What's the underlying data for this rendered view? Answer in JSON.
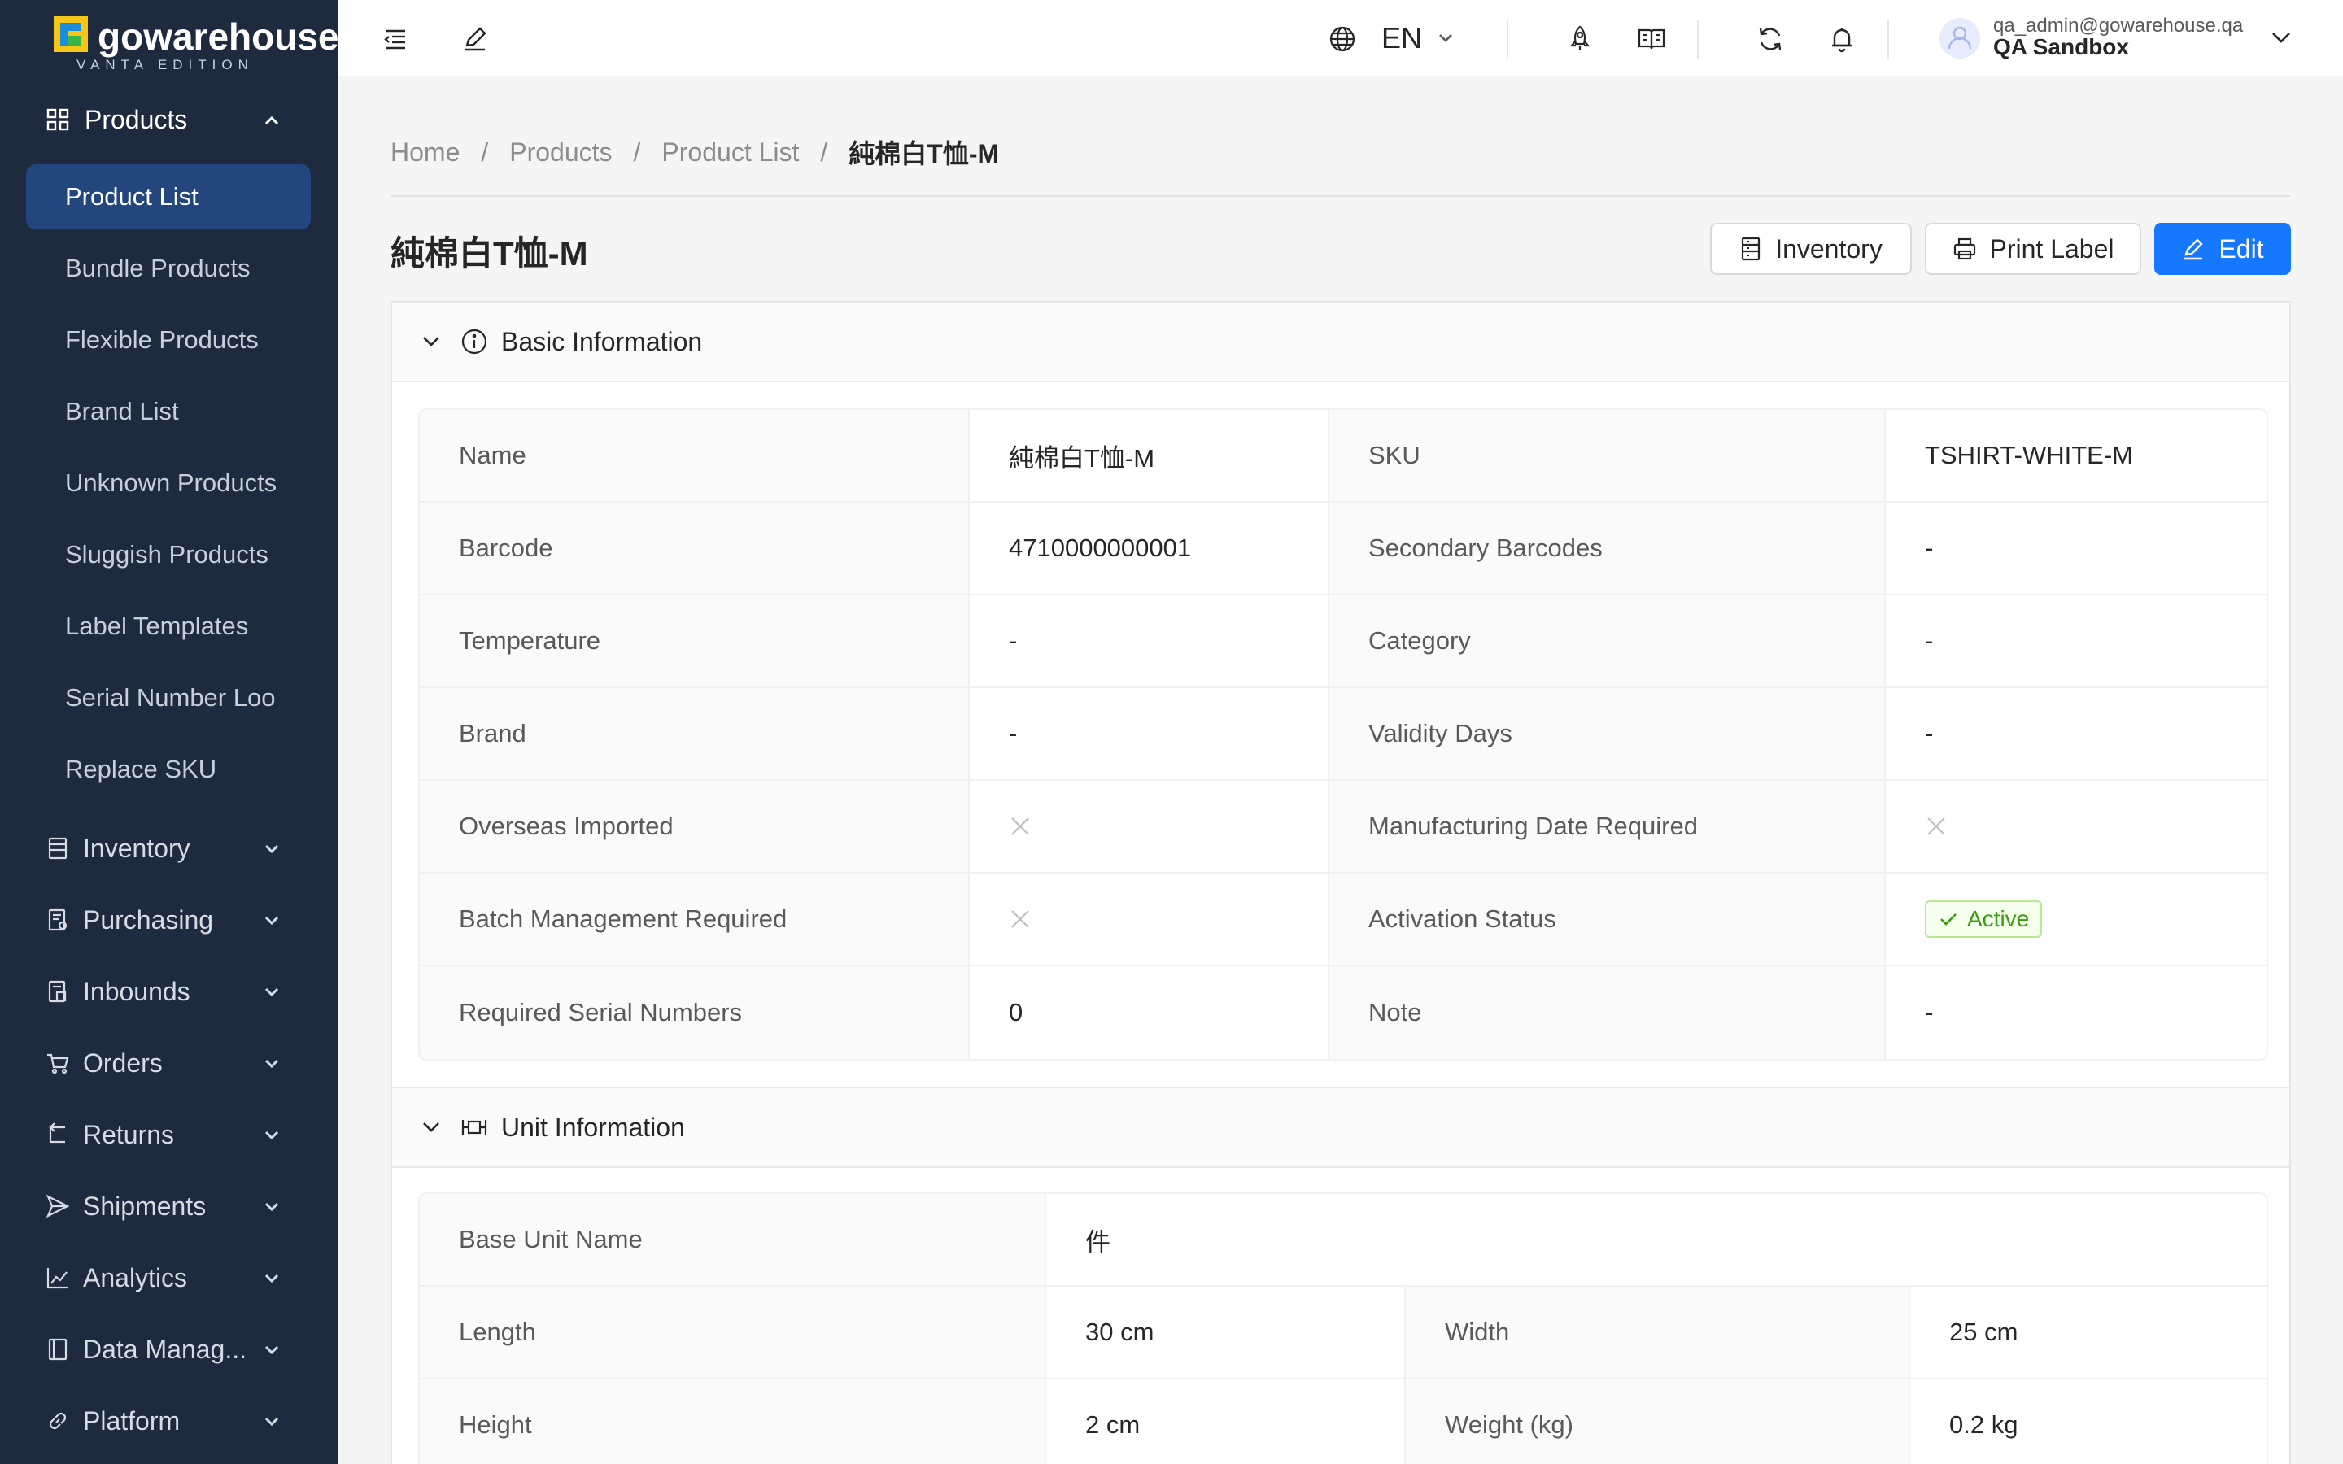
{
  "brand": {
    "name": "gowarehouse",
    "edition": "VANTA EDITION",
    "colors": {
      "yellow": "#f5c518",
      "blue": "#1a8fd8",
      "green": "#3bb54a"
    }
  },
  "sidebar": {
    "section": {
      "label": "Products",
      "icon": "grid-icon",
      "expanded": true
    },
    "sub_items": [
      {
        "label": "Product List",
        "active": true
      },
      {
        "label": "Bundle Products"
      },
      {
        "label": "Flexible Products"
      },
      {
        "label": "Brand List"
      },
      {
        "label": "Unknown Products"
      },
      {
        "label": "Sluggish Products"
      },
      {
        "label": "Label Templates"
      },
      {
        "label": "Serial Number Loo"
      },
      {
        "label": "Replace SKU"
      }
    ],
    "menu": [
      {
        "label": "Inventory",
        "icon": "inventory-icon"
      },
      {
        "label": "Purchasing",
        "icon": "purchasing-icon"
      },
      {
        "label": "Inbounds",
        "icon": "inbounds-icon"
      },
      {
        "label": "Orders",
        "icon": "cart-icon"
      },
      {
        "label": "Returns",
        "icon": "return-icon"
      },
      {
        "label": "Shipments",
        "icon": "send-icon"
      },
      {
        "label": "Analytics",
        "icon": "line-chart-icon"
      },
      {
        "label": "Data Manag...",
        "icon": "book-icon"
      },
      {
        "label": "Platform",
        "icon": "link-icon"
      }
    ]
  },
  "topbar": {
    "language": "EN",
    "user_email": "qa_admin@gowarehouse.qa",
    "user_org": "QA Sandbox"
  },
  "breadcrumb": {
    "items": [
      "Home",
      "Products",
      "Product List"
    ],
    "current": "純棉白T恤-M",
    "separator": "/"
  },
  "page": {
    "title": "純棉白T恤-M",
    "buttons": {
      "inventory": "Inventory",
      "print_label": "Print Label",
      "edit": "Edit"
    }
  },
  "basic_info": {
    "title": "Basic Information",
    "rows": [
      [
        {
          "label": "Name",
          "value": "純棉白T恤-M"
        },
        {
          "label": "SKU",
          "value": "TSHIRT-WHITE-M"
        }
      ],
      [
        {
          "label": "Barcode",
          "value": "4710000000001"
        },
        {
          "label": "Secondary Barcodes",
          "value": "-"
        }
      ],
      [
        {
          "label": "Temperature",
          "value": "-"
        },
        {
          "label": "Category",
          "value": "-"
        }
      ],
      [
        {
          "label": "Brand",
          "value": "-"
        },
        {
          "label": "Validity Days",
          "value": "-"
        }
      ],
      [
        {
          "label": "Overseas Imported",
          "value": "false"
        },
        {
          "label": "Manufacturing Date Required",
          "value": "false"
        }
      ],
      [
        {
          "label": "Batch Management Required",
          "value": "false"
        },
        {
          "label": "Activation Status",
          "value": "Active"
        }
      ],
      [
        {
          "label": "Required Serial Numbers",
          "value": "0"
        },
        {
          "label": "Note",
          "value": "-"
        }
      ]
    ]
  },
  "unit_info": {
    "title": "Unit Information",
    "base_unit": {
      "label": "Base Unit Name",
      "value": "件"
    },
    "rows": [
      [
        {
          "label": "Length",
          "value": "30 cm"
        },
        {
          "label": "Width",
          "value": "25 cm"
        }
      ],
      [
        {
          "label": "Height",
          "value": "2 cm"
        },
        {
          "label": "Weight (kg)",
          "value": "0.2 kg"
        }
      ]
    ]
  },
  "colors": {
    "sidebar_bg": "#1e2a3d",
    "sidebar_active": "#23467f",
    "primary": "#1677ff",
    "success": "#389e0d"
  }
}
